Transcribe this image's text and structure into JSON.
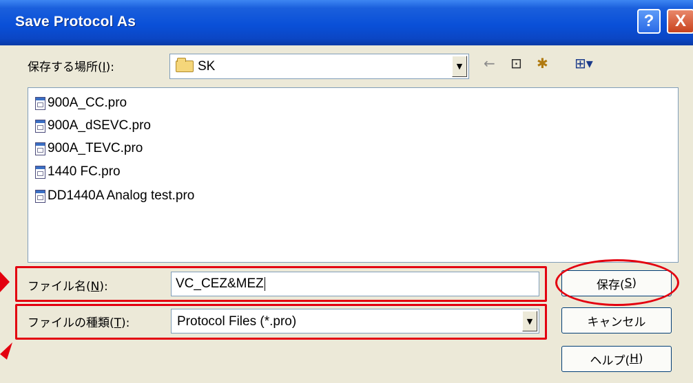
{
  "dialog": {
    "title": "Save Protocol As",
    "help_button": "?",
    "close_button": "X"
  },
  "location": {
    "label_prefix": "保存する場所(",
    "label_accel": "I",
    "label_suffix": "):",
    "value": "SK",
    "icon": "folder-icon"
  },
  "toolbar": {
    "back_icon": "←",
    "up_icon": "⊡",
    "new_folder_icon": "✱",
    "view_menu_icon": "⊞▾"
  },
  "files": [
    {
      "name": "900A_CC.pro",
      "icon": "file-icon"
    },
    {
      "name": "900A_dSEVC.pro",
      "icon": "file-icon"
    },
    {
      "name": "900A_TEVC.pro",
      "icon": "file-icon"
    },
    {
      "name": "1440 FC.pro",
      "icon": "file-icon"
    },
    {
      "name": "DD1440A Analog test.pro",
      "icon": "file-icon"
    }
  ],
  "filename": {
    "label_prefix": "ファイル名(",
    "label_accel": "N",
    "label_suffix": "):",
    "value": "VC_CEZ&MEZ"
  },
  "filetype": {
    "label_prefix": "ファイルの種類(",
    "label_accel": "T",
    "label_suffix": "):",
    "value": "Protocol Files (*.pro)"
  },
  "buttons": {
    "save_prefix": "保存(",
    "save_accel": "S",
    "save_suffix": ")",
    "cancel": "キャンセル",
    "help_prefix": "ヘルプ(",
    "help_accel": "H",
    "help_suffix": ")"
  },
  "annotations": {
    "highlight_color": "#e3000f"
  }
}
